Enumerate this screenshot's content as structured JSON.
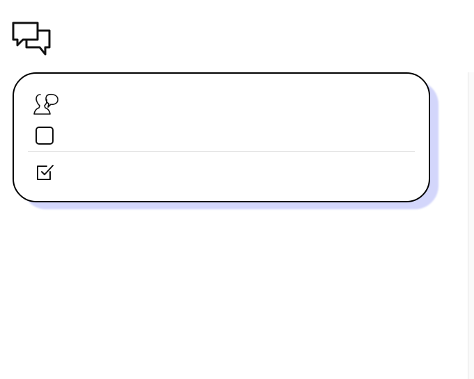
{
  "header": {
    "icon": "chat-bubbles-icon"
  },
  "panel": {
    "rows": [
      {
        "icon": "user-speaking-icon",
        "label": ""
      },
      {
        "icon": "checkbox-empty-icon",
        "label": "",
        "checked": false
      },
      {
        "icon": "checkbox-checked-icon",
        "label": "",
        "checked": true
      }
    ]
  },
  "colors": {
    "panel_border": "#000000",
    "panel_shadow": "#d3d6fb",
    "divider": "#dcdcdc"
  }
}
